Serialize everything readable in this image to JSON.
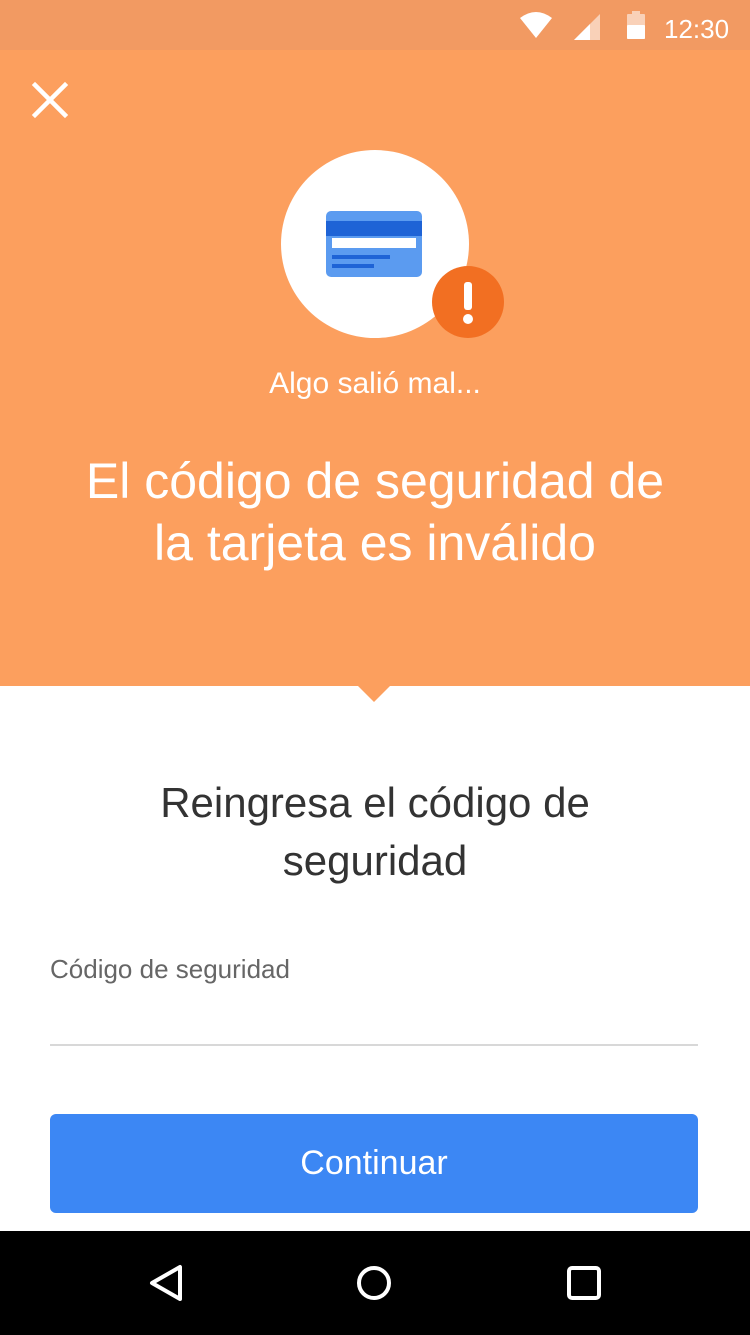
{
  "status_bar": {
    "time": "12:30",
    "wifi_icon": "wifi-icon",
    "signal_icon": "cell-signal-icon",
    "battery_icon": "battery-icon"
  },
  "header": {
    "close_icon": "close-icon",
    "illustration_icon": "credit-card-icon",
    "alert_icon": "exclamation-icon",
    "eyebrow": "Algo salió mal...",
    "title": "El código de seguridad de la tarjeta es inválido",
    "background_color": "#fc9f5e",
    "alert_color": "#f26f22"
  },
  "form": {
    "prompt": "Reingresa el código de seguridad",
    "field_label": "Código de seguridad",
    "field_value": "",
    "submit_label": "Continuar",
    "button_color": "#3c87f4"
  },
  "nav_bar": {
    "back_icon": "back-icon",
    "home_icon": "home-icon",
    "recents_icon": "recents-icon"
  }
}
